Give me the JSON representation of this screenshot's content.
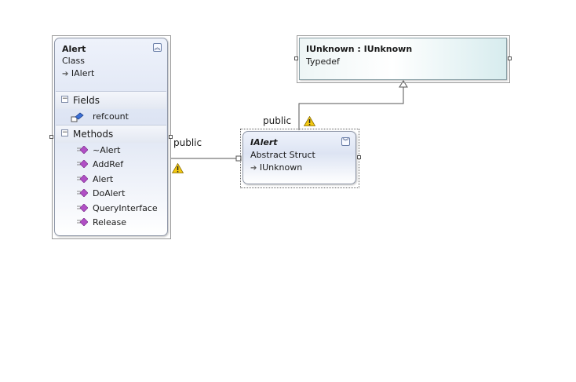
{
  "alert_class": {
    "name": "Alert",
    "kind": "Class",
    "base": "IAlert",
    "fields_label": "Fields",
    "fields": [
      "refcount"
    ],
    "methods_label": "Methods",
    "methods": [
      "~Alert",
      "AddRef",
      "Alert",
      "DoAlert",
      "QueryInterface",
      "Release"
    ]
  },
  "ialert_struct": {
    "name": "IAlert",
    "kind": "Abstract Struct",
    "base": "IUnknown"
  },
  "iunknown_typedef": {
    "name": "IUnknown : IUnknown",
    "kind": "Typedef"
  },
  "connectors": {
    "alert_to_ialert_label": "public",
    "ialert_to_iunknown_label": "public"
  },
  "icons": {
    "collapse": "collapse-chevron-up-icon",
    "expand": "expand-chevron-down-icon",
    "inherit_arrow": "inheritance-arrow-icon",
    "field": "field-icon",
    "method": "method-icon",
    "warning": "warning-icon"
  },
  "colors": {
    "method_icon": "#b14fc5",
    "warning": "#f2c811"
  }
}
